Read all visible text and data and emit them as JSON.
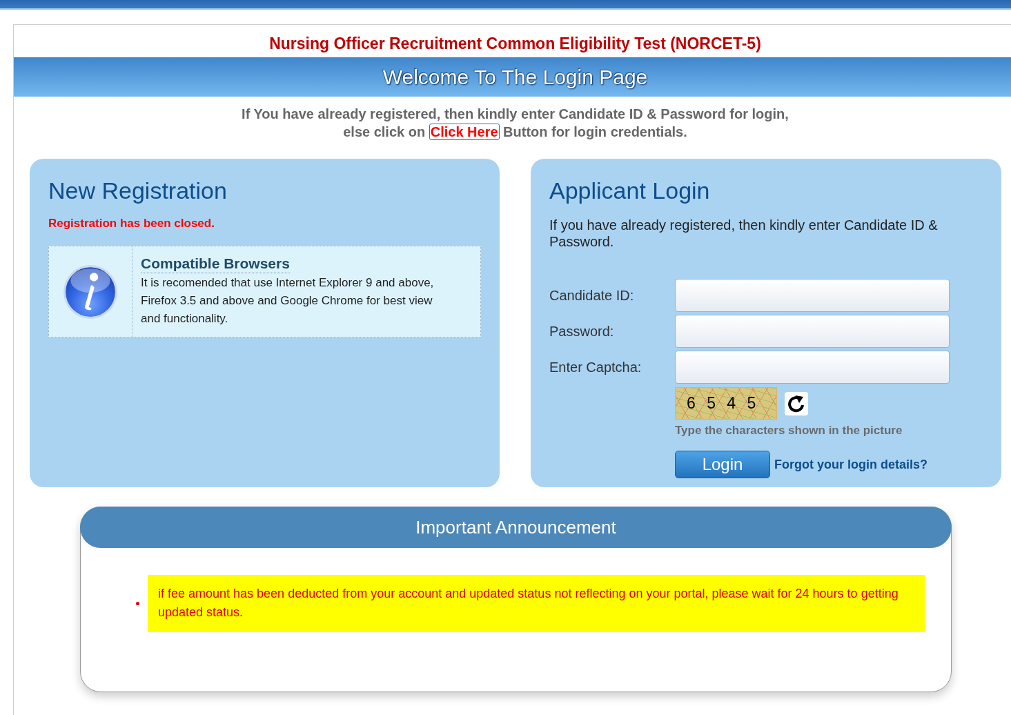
{
  "header": {
    "title": "Nursing Officer Recruitment Common Eligibility Test (NORCET-5)",
    "banner": "Welcome To The Login Page"
  },
  "intro": {
    "line_1": "If You have already registered, then kindly enter Candidate ID & Password for login,",
    "line_2_before": "else click on",
    "link": "Click Here",
    "line_2_after": "Button for login credentials."
  },
  "new_registration": {
    "title": "New Registration",
    "notice": "Registration has been closed.",
    "info": {
      "title": "Compatible Browsers",
      "text": "It is recomended that use Internet Explorer 9 and above, Firefox 3.5 and above and Google Chrome for best view and functionality."
    }
  },
  "applicant_login": {
    "title": "Applicant Login",
    "description": "If you have already registered, then kindly enter Candidate ID & Password.",
    "fields": [
      {
        "label": "Candidate ID:"
      },
      {
        "label": "Password:"
      },
      {
        "label": "Enter Captcha:"
      }
    ],
    "captcha": {
      "text": "6 5 4 5",
      "hint": "Type the characters shown in the picture"
    },
    "login_button": "Login",
    "forgot_link": "Forgot your login details?"
  },
  "announcement": {
    "title": "Important Announcement",
    "items": [
      "if fee amount has been deducted from your account and updated status not reflecting on your portal, please wait for 24 hours to getting updated status."
    ]
  }
}
